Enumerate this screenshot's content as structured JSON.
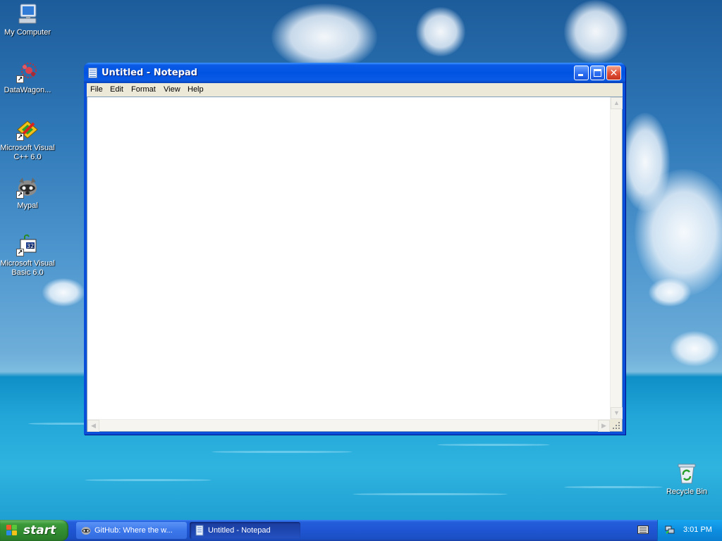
{
  "desktop": {
    "icons": [
      {
        "label": "My Computer"
      },
      {
        "label": "DataWagon..."
      },
      {
        "label": "Microsoft Visual C++ 6.0"
      },
      {
        "label": "Mypal"
      },
      {
        "label": "Microsoft Visual Basic 6.0"
      },
      {
        "label": "Recycle Bin"
      }
    ]
  },
  "notepad": {
    "title": "Untitled - Notepad",
    "menu": [
      "File",
      "Edit",
      "Format",
      "View",
      "Help"
    ],
    "content": ""
  },
  "taskbar": {
    "start_label": "start",
    "items": [
      {
        "label": "GitHub: Where the w...",
        "active": false,
        "icon": "mypal-icon"
      },
      {
        "label": "Untitled - Notepad",
        "active": true,
        "icon": "notepad-icon"
      }
    ],
    "clock": "3:01 PM"
  }
}
